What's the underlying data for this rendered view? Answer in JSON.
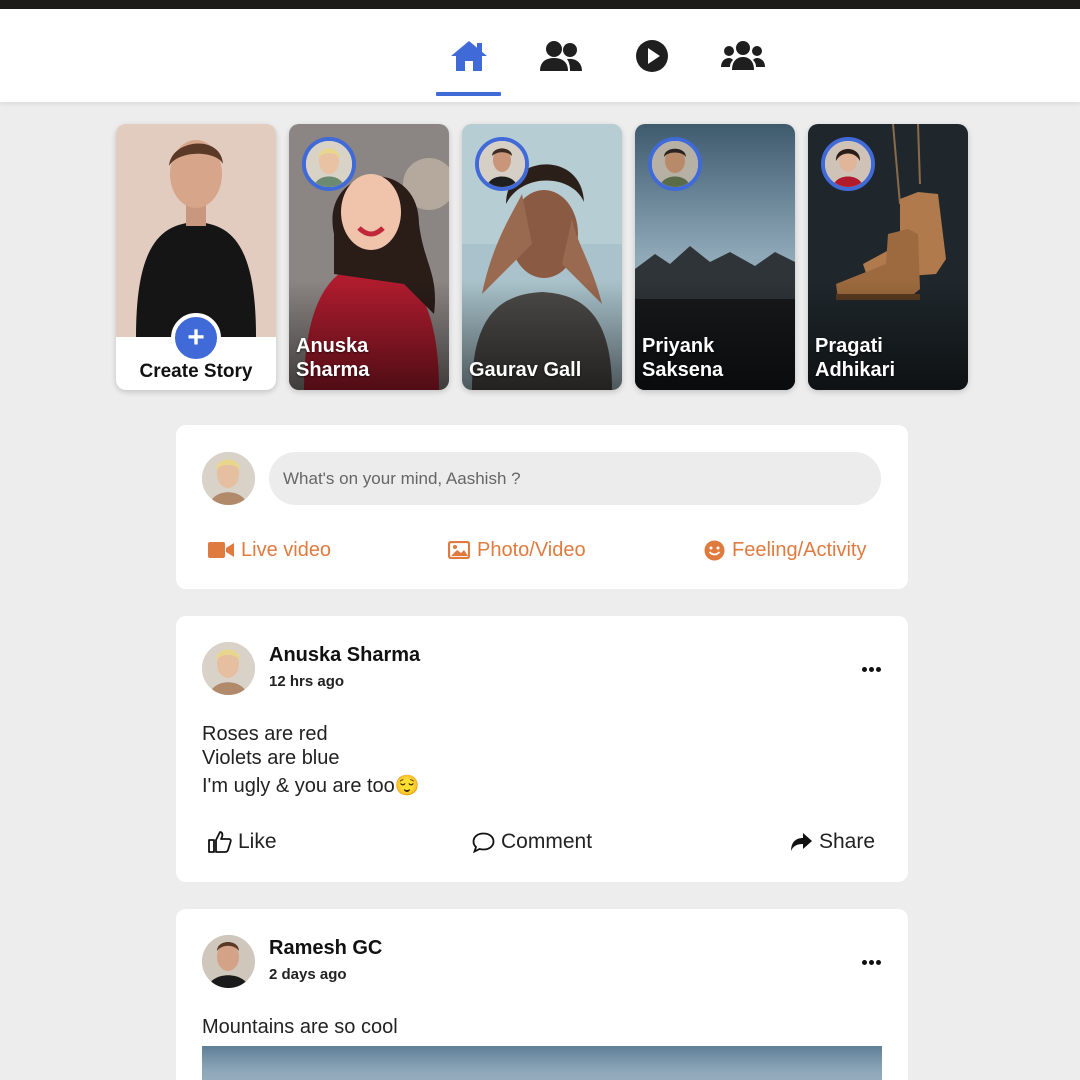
{
  "nav": {
    "items": [
      {
        "name": "home",
        "icon": "home-icon",
        "active": true
      },
      {
        "name": "friends",
        "icon": "friends-icon",
        "active": false
      },
      {
        "name": "watch",
        "icon": "play-icon",
        "active": false
      },
      {
        "name": "groups",
        "icon": "groups-icon",
        "active": false
      }
    ]
  },
  "stories": {
    "create_label": "Create Story",
    "items": [
      {
        "name": "Anuska\nSharma"
      },
      {
        "name": "Gaurav Gall"
      },
      {
        "name": "Priyank\nSaksena"
      },
      {
        "name": "Pragati\nAdhikari"
      }
    ]
  },
  "composer": {
    "placeholder": "What's on your mind, Aashish ?",
    "actions": {
      "live": "Live video",
      "photo": "Photo/Video",
      "feeling": "Feeling/Activity"
    }
  },
  "posts": [
    {
      "author": "Anuska Sharma",
      "time": "12 hrs ago",
      "lines": [
        "Roses are red",
        "Violets are blue",
        "I'm ugly & you are too😌"
      ],
      "reactions": {
        "like": "Like",
        "comment": "Comment",
        "share": "Share"
      }
    },
    {
      "author": "Ramesh GC",
      "time": "2 days ago",
      "lines": [
        "Mountains are so cool"
      ]
    }
  ],
  "colors": {
    "accent": "#3f6ad8",
    "action_orange": "#e07b3f",
    "background": "#ededed"
  }
}
